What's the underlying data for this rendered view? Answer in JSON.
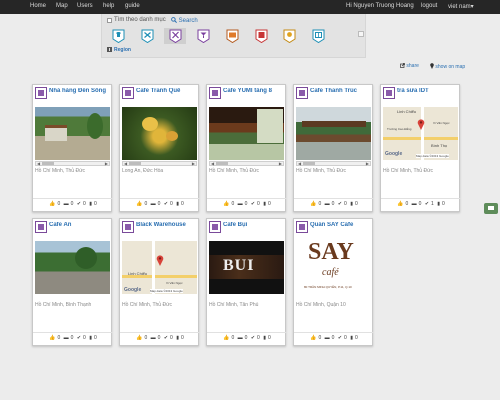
{
  "nav": {
    "left": [
      "Home",
      "Map",
      "Users",
      "help",
      "guide"
    ],
    "user": "Hi Nguyen Truong Hoang",
    "logout": "logout",
    "lang": "viet nam▾"
  },
  "filter": {
    "label": "Tìm theo danh mục",
    "search": "Search",
    "region": "Region",
    "categories": [
      {
        "icon": "shirt-category-icon",
        "color": "#1d8fb6"
      },
      {
        "icon": "tools-category-icon",
        "color": "#1d8fb6"
      },
      {
        "icon": "fork-knife-category-icon",
        "color": "#7a3f9e"
      },
      {
        "icon": "cocktail-category-icon",
        "color": "#7a3f9e"
      },
      {
        "icon": "film-category-icon",
        "color": "#e07a2a"
      },
      {
        "icon": "building-category-icon",
        "color": "#c73536"
      },
      {
        "icon": "bulb-category-icon",
        "color": "#e0a21e"
      },
      {
        "icon": "book-category-icon",
        "color": "#1d8fb6"
      }
    ]
  },
  "actions": {
    "share": "share",
    "show_on_map": "show on map"
  },
  "cards": [
    {
      "title": "Nhà hàng Đền Sông",
      "address": "Hồ Chí Minh, Thủ Đức",
      "likes": 0,
      "comments": 0,
      "checkins": 0,
      "bookmarks": 0,
      "image": "photo-restaurant"
    },
    {
      "title": "Cafe Tranh Quê",
      "address": "Long An, Đức Hòa",
      "likes": 0,
      "comments": 0,
      "checkins": 0,
      "bookmarks": 0,
      "image": "photo-garden"
    },
    {
      "title": "Cafe YUMI tầng 8",
      "address": "Hồ Chí Minh, Thủ Đức",
      "likes": 0,
      "comments": 0,
      "checkins": 0,
      "bookmarks": 0,
      "image": "photo-cafe-terrace"
    },
    {
      "title": "Cafe Thanh Trúc",
      "address": "Hồ Chí Minh, Thủ Đức",
      "likes": 0,
      "comments": 0,
      "checkins": 0,
      "bookmarks": 0,
      "image": "photo-outdoor-cafe"
    },
    {
      "title": "trà sữa IDT",
      "address": "Hồ Chí Minh, Thủ Đức",
      "likes": 0,
      "comments": 0,
      "checkins": 1,
      "bookmarks": 0,
      "image": "map-view"
    },
    {
      "title": "Cafe An",
      "address": "Hồ Chí Minh, Bình Thạnh",
      "likes": 0,
      "comments": 0,
      "checkins": 0,
      "bookmarks": 0,
      "image": "photo-street"
    },
    {
      "title": "Black Warehouse",
      "address": "Hồ Chí Minh, Thủ Đức",
      "likes": 0,
      "comments": 0,
      "checkins": 0,
      "bookmarks": 0,
      "image": "map-view"
    },
    {
      "title": "Cafe Bụi",
      "address": "Hồ Chí Minh, Tân Phú",
      "likes": 0,
      "comments": 0,
      "checkins": 0,
      "bookmarks": 0,
      "image": "photo-bui-sign"
    },
    {
      "title": "Quán SAY Cafe",
      "address": "Hồ Chí Minh, Quận 10",
      "likes": 0,
      "comments": 0,
      "checkins": 0,
      "bookmarks": 0,
      "image": "logo-say-cafe"
    }
  ],
  "map": {
    "labels": [
      "Linh Chiểu",
      "Bình Thọ",
      "Vi Văn Ngọc",
      "Google",
      "Map data ©2013 Google",
      "Trường Cao Đẳng"
    ],
    "logo_text": [
      "SAY",
      "café",
      "80 TRẦN MINH QUYỀN, P.11, Q.10"
    ],
    "bui_text": "BUI"
  }
}
